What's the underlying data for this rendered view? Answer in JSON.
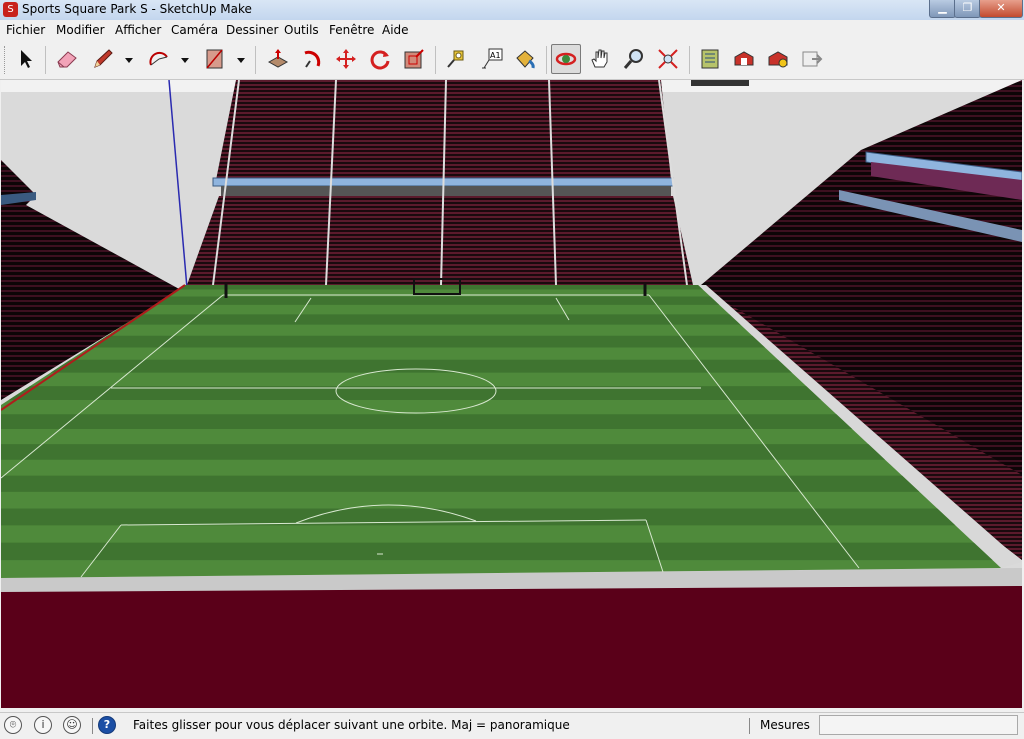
{
  "window": {
    "title": "Sports Square Park S - SketchUp Make",
    "min_symbol": "▁",
    "max_symbol": "❐",
    "close_symbol": "✕"
  },
  "menu": [
    {
      "id": "fichier",
      "label": "Fichier"
    },
    {
      "id": "modifier",
      "label": "Modifier"
    },
    {
      "id": "afficher",
      "label": "Afficher"
    },
    {
      "id": "camera",
      "label": "Caméra"
    },
    {
      "id": "dessiner",
      "label": "Dessiner"
    },
    {
      "id": "outils",
      "label": "Outils"
    },
    {
      "id": "fenetre",
      "label": "Fenêtre"
    },
    {
      "id": "aide",
      "label": "Aide"
    }
  ],
  "toolbar": {
    "tools": [
      {
        "id": "select",
        "icon": "arrow-cursor-icon"
      },
      {
        "id": "eraser",
        "icon": "eraser-icon"
      },
      {
        "id": "pencil",
        "icon": "pencil-icon"
      },
      {
        "id": "arc",
        "icon": "arc-icon"
      },
      {
        "id": "rectangle",
        "icon": "rectangle-icon"
      },
      {
        "id": "push-pull",
        "icon": "push-pull-icon"
      },
      {
        "id": "follow-me",
        "icon": "follow-me-icon"
      },
      {
        "id": "move",
        "icon": "move-icon"
      },
      {
        "id": "rotate",
        "icon": "rotate-icon"
      },
      {
        "id": "offset",
        "icon": "offset-icon"
      },
      {
        "id": "tape",
        "icon": "tape-measure-icon"
      },
      {
        "id": "text",
        "icon": "text-label-icon",
        "text": "A1"
      },
      {
        "id": "paint",
        "icon": "paint-bucket-icon"
      },
      {
        "id": "orbit",
        "icon": "orbit-icon",
        "active": true
      },
      {
        "id": "pan",
        "icon": "pan-hand-icon"
      },
      {
        "id": "zoom",
        "icon": "zoom-icon"
      },
      {
        "id": "zoom-extents",
        "icon": "zoom-extents-icon"
      },
      {
        "id": "warehouse",
        "icon": "3d-warehouse-icon"
      },
      {
        "id": "share",
        "icon": "share-model-icon"
      },
      {
        "id": "extension",
        "icon": "extension-warehouse-icon"
      },
      {
        "id": "layout",
        "icon": "send-to-layout-icon"
      }
    ]
  },
  "colors": {
    "grass_light": "#4f8a3b",
    "grass_dark": "#3f7430",
    "ground": "#5a0019",
    "stand_seat": "#5b1a2c",
    "roof_blue": "#8fb4de"
  },
  "status": {
    "icons": [
      "geo-location-icon",
      "info-icon",
      "user-icon",
      "help-icon"
    ],
    "help_text": "?",
    "info_text": "i",
    "message": "Faites glisser pour vous déplacer suivant une orbite.  Maj = panoramique",
    "measure_label": "Mesures",
    "measure_value": ""
  }
}
